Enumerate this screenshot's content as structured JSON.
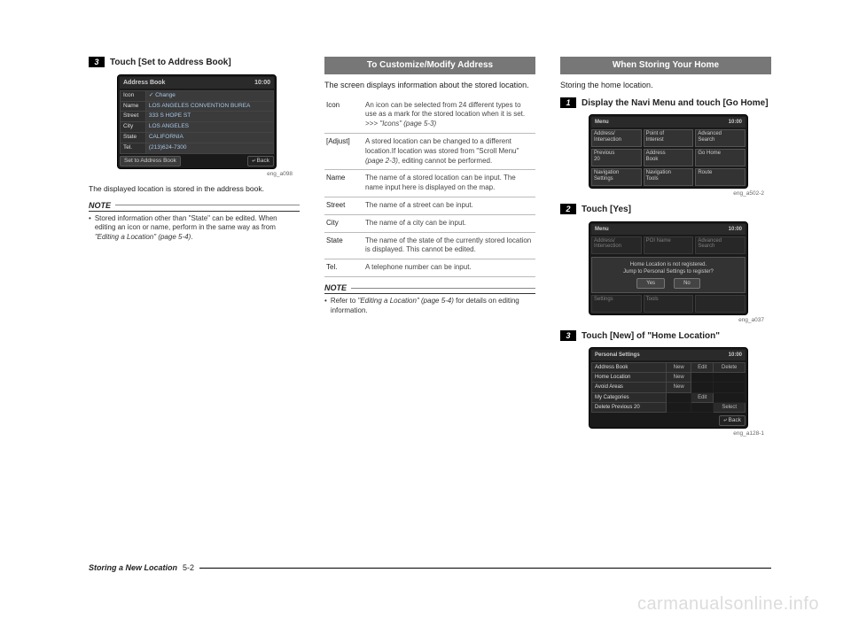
{
  "col1": {
    "step_num": "3",
    "step_text": "Touch [Set to Address Book]",
    "screen": {
      "title": "Address Book",
      "time": "10:00",
      "rows": [
        {
          "k": "Icon",
          "v": "✓ Change"
        },
        {
          "k": "Name",
          "v": "LOS ANGELES CONVENTION BUREA"
        },
        {
          "k": "Street",
          "v": "333 S HOPE ST"
        },
        {
          "k": "City",
          "v": "LOS ANGELES"
        },
        {
          "k": "State",
          "v": "CALIFORNIA"
        },
        {
          "k": "Tel.",
          "v": "(213)624-7300"
        }
      ],
      "set_btn": "Set to Address Book",
      "back_btn": "Back",
      "cap": "eng_a098"
    },
    "after": "The displayed location is stored in the address book.",
    "note_head": "NOTE",
    "note": "Stored information other than \"State\" can be edited. When editing an icon or name, perform in the same way as from ",
    "note_ref": "\"Editing a Location\" (page 5-4)",
    "note_end": "."
  },
  "col2": {
    "heading": "To Customize/Modify Address",
    "intro": "The screen displays information about the stored location.",
    "rows": [
      {
        "k": "Icon",
        "v": "An icon can be selected from 24 different types to use as a mark for the stored location when it is set.",
        "extra": ">>> \"Icons\" (page 5-3)"
      },
      {
        "k": "[Adjust]",
        "v": "A stored location can be changed to a different location.If location was stored from \"Scroll Menu\" ",
        "ref": "(page 2-3)",
        "tail": ", editing cannot be performed."
      },
      {
        "k": "Name",
        "v": "The name of a stored location can be input. The name input here is displayed on the map."
      },
      {
        "k": "Street",
        "v": "The name of a street can be input."
      },
      {
        "k": "City",
        "v": "The name of a city can be input."
      },
      {
        "k": "State",
        "v": "The name of the state of the currently stored location is displayed. This cannot be edited."
      },
      {
        "k": "Tel.",
        "v": "A telephone number can be input."
      }
    ],
    "note_head": "NOTE",
    "note_pre": "Refer to ",
    "note_ref": "\"Editing a Location\" (page 5-4)",
    "note_post": " for details on editing information."
  },
  "col3": {
    "heading": "When Storing Your Home",
    "intro": "Storing the home location.",
    "step1_num": "1",
    "step1_text": "Display the Navi Menu and touch [Go Home]",
    "menu": {
      "title": "Menu",
      "time": "10:00",
      "cells": [
        "Address/\nIntersection",
        "Point of\nInterest",
        "Advanced\nSearch",
        "Previous\n20",
        "Address\nBook",
        "Go Home",
        "Navigation\nSettings",
        "Navigation\nTools",
        "Route"
      ],
      "cap": "eng_a502-2"
    },
    "step2_num": "2",
    "step2_text": "Touch [Yes]",
    "dialog": {
      "title": "Menu",
      "time": "10:00",
      "line1": "Home Location is not registered.",
      "line2": "Jump to Personal Settings to register?",
      "yes": "Yes",
      "no": "No",
      "cap": "eng_a037",
      "dim_cells": [
        "Address/\nIntersection",
        "POI Name",
        "Advanced\nSearch",
        "Settings",
        "Tools"
      ]
    },
    "step3_num": "3",
    "step3_text": "Touch [New] of \"Home Location\"",
    "ps": {
      "title": "Personal Settings",
      "time": "10:00",
      "rows": [
        [
          "Address Book",
          "New",
          "Edit",
          "Delete"
        ],
        [
          "Home Location",
          "New",
          "",
          ""
        ],
        [
          "Avoid Areas",
          "New",
          "",
          ""
        ],
        [
          "My Categories",
          "",
          "Edit",
          ""
        ],
        [
          "Delete Previous 20",
          "",
          "",
          "Select"
        ]
      ],
      "back": "Back",
      "cap": "eng_a128-1"
    }
  },
  "footer": {
    "title": "Storing a New Location",
    "page": "5-2"
  },
  "watermark": "carmanualsonline.info"
}
